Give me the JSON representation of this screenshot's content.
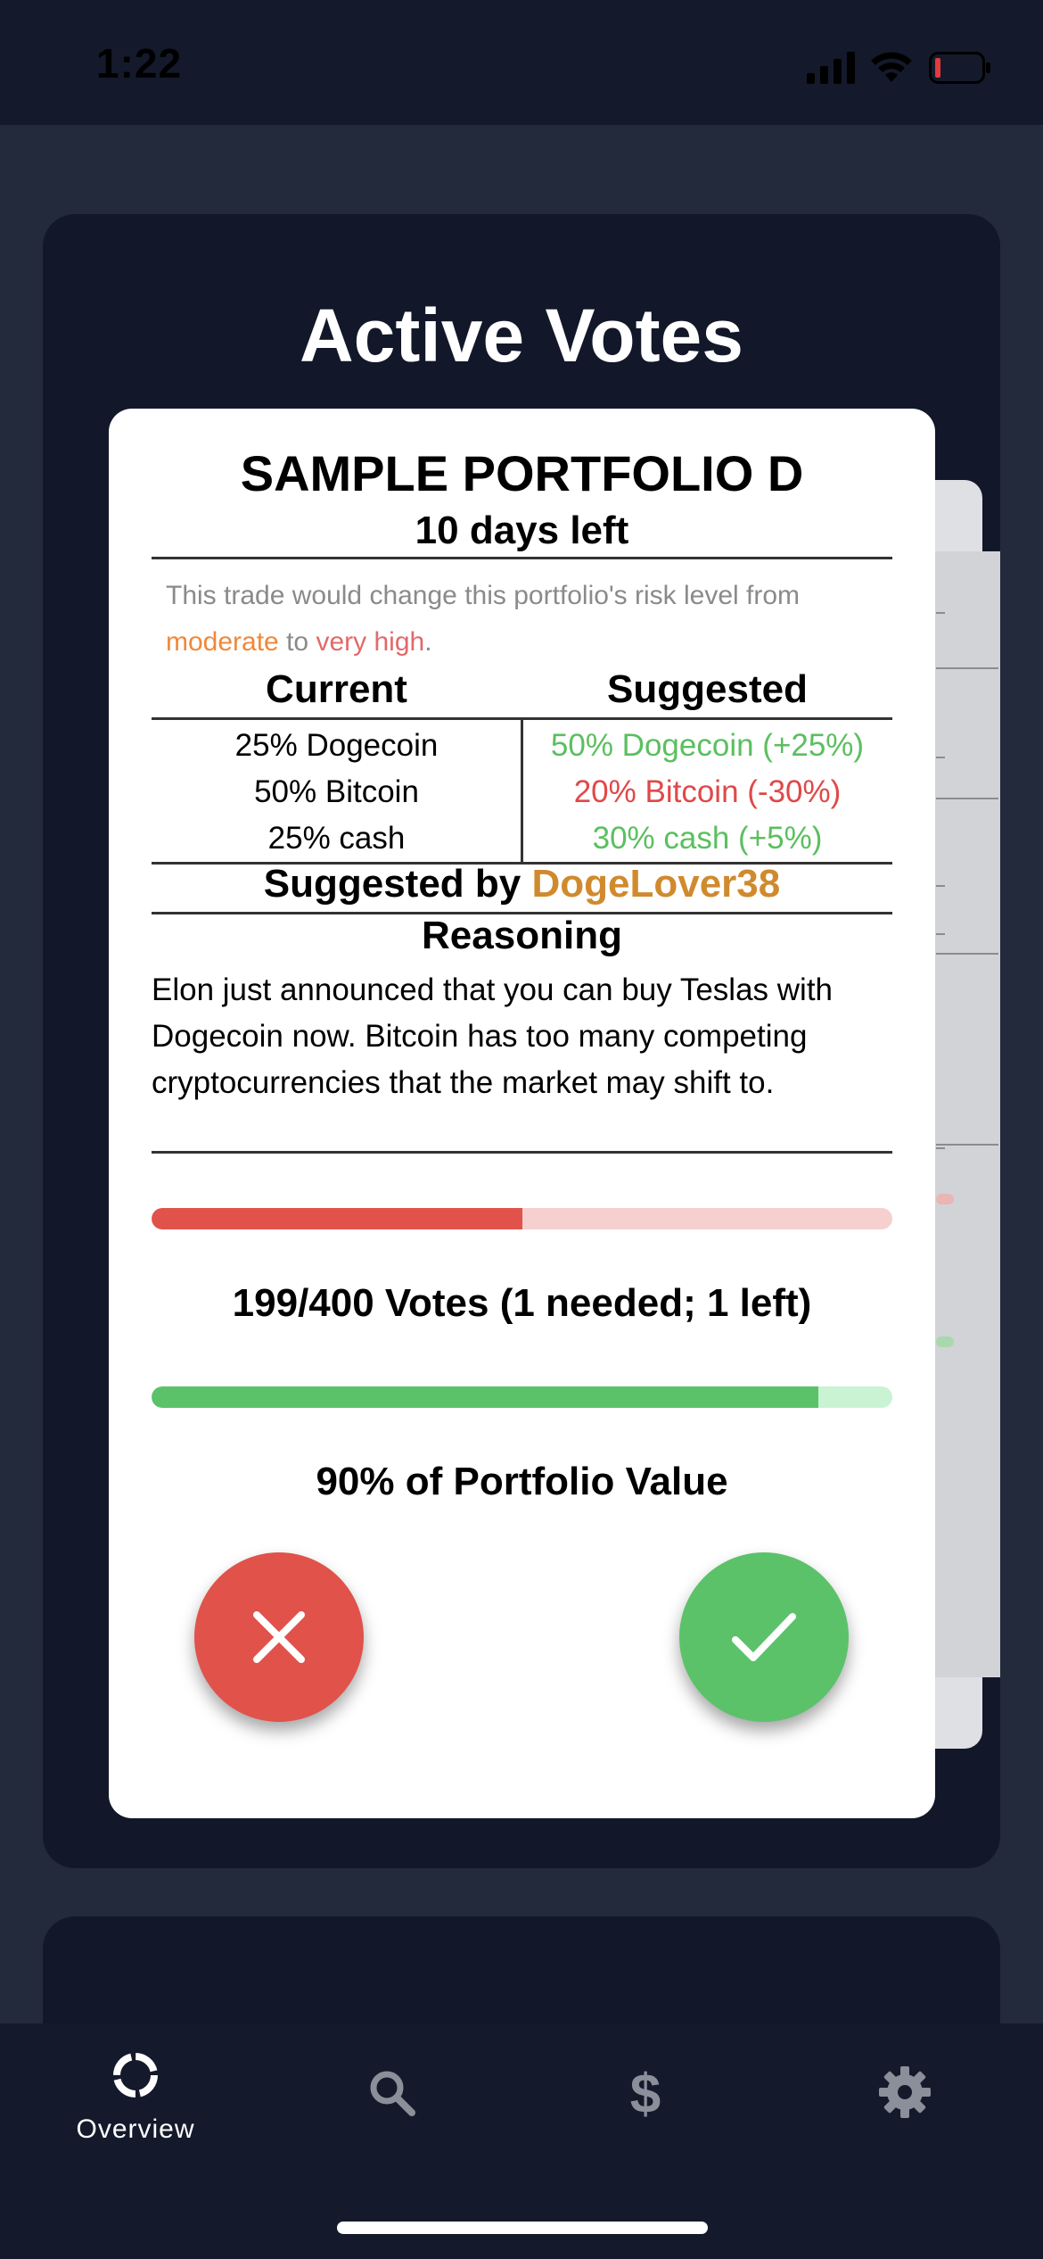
{
  "status_bar": {
    "time": "1:22"
  },
  "panel": {
    "title": "Active Votes"
  },
  "card": {
    "title": "SAMPLE PORTFOLIO D",
    "subtitle": "10 days left",
    "risk_prefix": "This trade would change this portfolio's risk level from",
    "risk_from": "moderate",
    "risk_mid": "to",
    "risk_to": "very high",
    "risk_suffix": ".",
    "current_header": "Current",
    "suggested_header": "Suggested",
    "current": [
      "25% Dogecoin",
      "50% Bitcoin",
      "25% cash"
    ],
    "suggested": [
      {
        "text": "50% Dogecoin (+25%)",
        "trend": "up"
      },
      {
        "text": "20% Bitcoin (-30%)",
        "trend": "down"
      },
      {
        "text": "30% cash (+5%)",
        "trend": "up"
      }
    ],
    "suggested_by_label": "Suggested by",
    "suggested_by_user": "DogeLover38",
    "reasoning_header": "Reasoning",
    "reasoning": "Elon just announced that you can buy Teslas with Dogecoin now. Bitcoin has too many competing cryptocurrencies that the market may shift to.",
    "votes_progress": 0.5,
    "votes_text": "199/400 Votes (1 needed; 1 left)",
    "value_progress": 0.9,
    "value_text": "90% of Portfolio Value"
  },
  "tabs": [
    {
      "label": "Overview",
      "icon": "overview-icon",
      "active": true
    },
    {
      "label": "",
      "icon": "search-icon",
      "active": false
    },
    {
      "label": "",
      "icon": "dollar-icon",
      "active": false
    },
    {
      "label": "",
      "icon": "gear-icon",
      "active": false
    }
  ],
  "colors": {
    "background": "#222a3c",
    "panel": "#121829",
    "reject": "#e0524a",
    "approve": "#5bc26a",
    "votes_bar": "#e0524a",
    "votes_track": "#f6cfcf",
    "value_bar": "#5bc26a",
    "value_track": "#c9f3d3",
    "suggester": "#d08a2e"
  }
}
